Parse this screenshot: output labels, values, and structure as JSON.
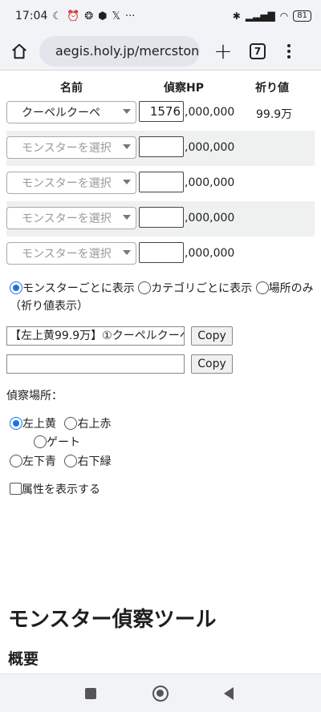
{
  "status_bar": {
    "time": "17:04",
    "battery": "81"
  },
  "browser": {
    "url": "aegis.holy.jp/mercstone",
    "tab_count": "7"
  },
  "table": {
    "headers": {
      "name": "名前",
      "hp": "偵察HP",
      "pray": "祈り値"
    },
    "rows": [
      {
        "monster": "クーペルクーペ",
        "hp": "1576",
        "suffix": ",000,000",
        "pray": "99.9万"
      },
      {
        "monster": "モンスターを選択",
        "hp": "",
        "suffix": ",000,000",
        "pray": ""
      },
      {
        "monster": "モンスターを選択",
        "hp": "",
        "suffix": ",000,000",
        "pray": ""
      },
      {
        "monster": "モンスターを選択",
        "hp": "",
        "suffix": ",000,000",
        "pray": ""
      },
      {
        "monster": "モンスターを選択",
        "hp": "",
        "suffix": ",000,000",
        "pray": ""
      }
    ]
  },
  "display_mode": {
    "options": [
      "モンスターごとに表示",
      "カテゴリごとに表示",
      "場所のみ（祈り値表示）"
    ],
    "selected": 0
  },
  "outputs": {
    "line1": "【左上黄99.9万】①クーペルクーペ",
    "line2": "",
    "copy_label": "Copy"
  },
  "recon": {
    "label": "偵察場所：",
    "locations": [
      "左上黄",
      "右上赤",
      "ゲート",
      "左下青",
      "右下緑"
    ],
    "selected": 0
  },
  "attribute": {
    "label": "属性を表示する",
    "checked": false
  },
  "page": {
    "title": "モンスター偵察ツール",
    "subtitle": "概要"
  }
}
